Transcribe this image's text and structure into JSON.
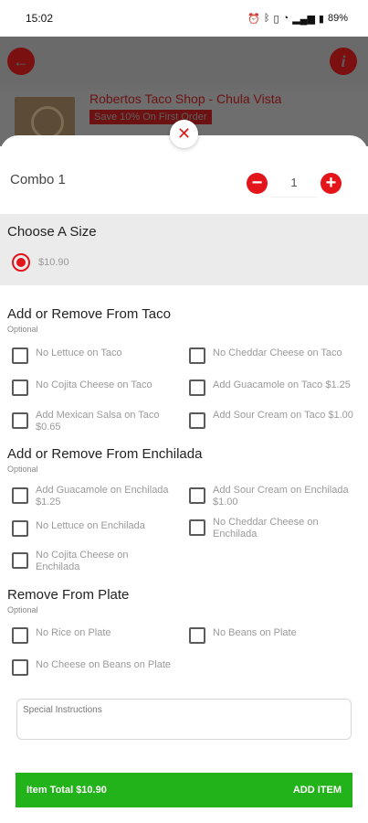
{
  "status": {
    "time": "15:02",
    "battery": "89%"
  },
  "store": {
    "name": "Robertos Taco Shop - Chula Vista",
    "promo": "Save 10% On First Order"
  },
  "item": {
    "name": "Combo 1",
    "quantity": "1"
  },
  "size": {
    "title": "Choose A Size",
    "option": "$10.90"
  },
  "groups": [
    {
      "title": "Add or Remove From Taco",
      "subtitle": "Optional",
      "options": [
        "No Lettuce on Taco",
        "No Cheddar Cheese on Taco",
        "No Cojita Cheese on Taco",
        "Add Guacamole on Taco $1.25",
        "Add Mexican Salsa on Taco $0.65",
        "Add Sour Cream on Taco $1.00"
      ]
    },
    {
      "title": "Add or Remove From Enchilada",
      "subtitle": "Optional",
      "options": [
        "Add Guacamole on Enchilada $1.25",
        "Add Sour Cream on Enchilada $1.00",
        "No Lettuce on Enchilada",
        "No Cheddar Cheese on Enchilada",
        "No Cojita Cheese on Enchilada"
      ]
    },
    {
      "title": "Remove From Plate",
      "subtitle": "Optional",
      "options": [
        "No Rice on Plate",
        "No Beans on Plate",
        "No Cheese on Beans on Plate"
      ]
    }
  ],
  "special_instructions": {
    "placeholder": "Special Instructions"
  },
  "footer": {
    "total": "Item Total $10.90",
    "action": "ADD ITEM"
  },
  "colors": {
    "accent": "#e4141b",
    "add_bar": "#22b21a"
  },
  "icons": [
    "back-arrow-icon",
    "info-icon",
    "close-icon",
    "minus-icon",
    "plus-icon"
  ]
}
